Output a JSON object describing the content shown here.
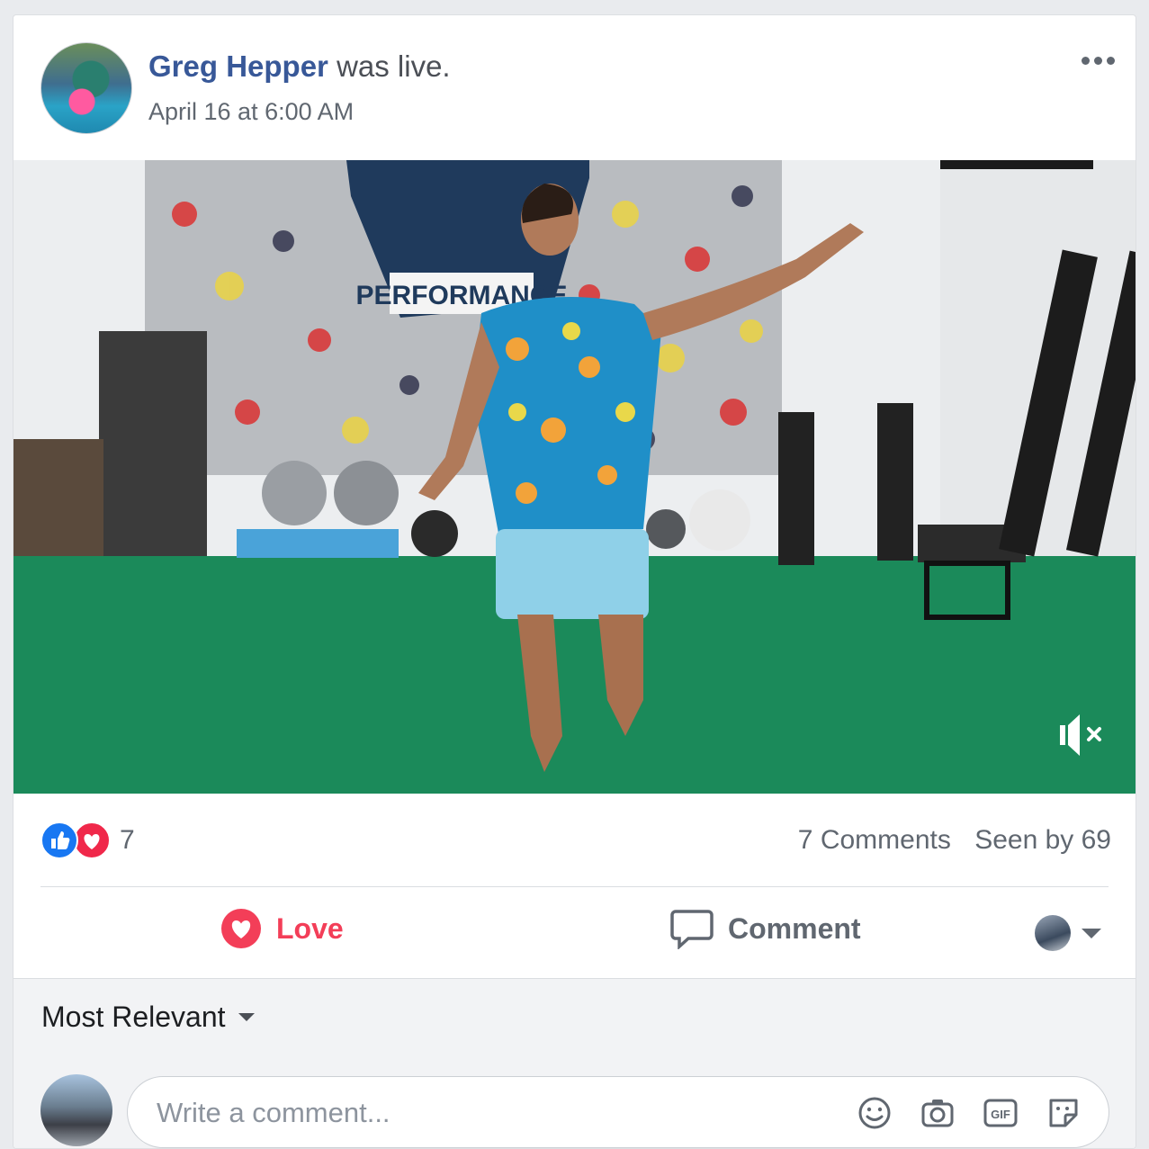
{
  "post": {
    "author": "Greg Hepper",
    "action": "was live.",
    "timestamp": "April 16 at 6:00 AM",
    "more_icon": "more-horizontal-icon"
  },
  "video": {
    "wall_sign": "PERFORMANCE",
    "muted": true,
    "mute_icon": "speaker-muted-icon"
  },
  "stats": {
    "reactions": [
      "like",
      "love"
    ],
    "reaction_count": "7",
    "comments": "7 Comments",
    "seen_by": "Seen by 69"
  },
  "actions": {
    "love_label": "Love",
    "comment_label": "Comment"
  },
  "comments": {
    "sort_label": "Most Relevant",
    "placeholder": "Write a comment...",
    "icons": [
      "emoji-icon",
      "camera-icon",
      "gif-icon",
      "sticker-icon"
    ]
  },
  "colors": {
    "author_link": "#385898",
    "love": "#f33e58",
    "like": "#1877f2",
    "muted_text": "#606770"
  }
}
